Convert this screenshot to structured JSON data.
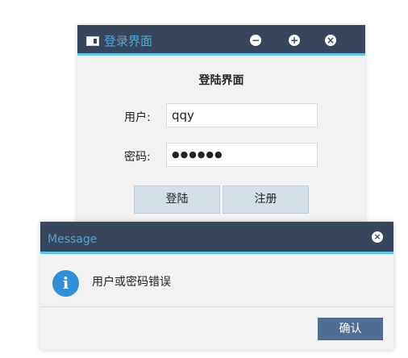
{
  "login_window": {
    "title": "登录界面",
    "controls": {
      "minimize": "−",
      "maximize": "+",
      "close": "×"
    },
    "heading": "登陆界面",
    "user_label": "用户:",
    "user_value": "qqy",
    "password_label": "密码:",
    "password_masked": "●●●●●●",
    "login_label": "登陆",
    "register_label": "注册"
  },
  "message_dialog": {
    "title": "Message",
    "close_glyph": "×",
    "info_glyph": "i",
    "text": "用户或密码错误",
    "ok_label": "确认"
  },
  "colors": {
    "titlebar": "#37465d",
    "accent_line": "#58c7ef",
    "ok_button": "#4f6c92",
    "info_icon": "#2f8fd8"
  },
  "icons": [
    "window-app-icon",
    "minimize-icon",
    "maximize-icon",
    "close-icon",
    "info-icon"
  ]
}
